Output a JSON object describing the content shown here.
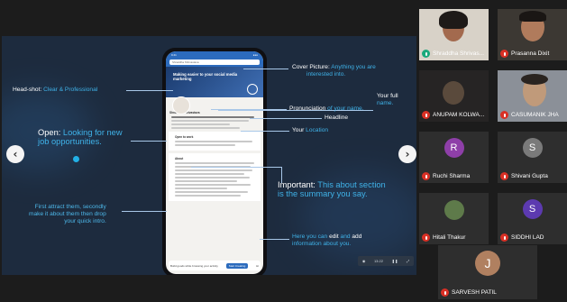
{
  "slide": {
    "annotations": {
      "headshot_label": "Head-shot:",
      "headshot_value": "Clear & Professional",
      "cover_label": "Cover Picture:",
      "cover_value_1": "Anything you are",
      "cover_value_2": "interested  into.",
      "fullname_1": "Your full",
      "fullname_2": "name.",
      "pronunciation_label": "Pronunciation",
      "pronunciation_rest": " of your name.",
      "headline": "Headline",
      "location_prefix": "Your ",
      "location_value": "Location",
      "open_label": "Open:",
      "open_value_1": "Looking for new",
      "open_value_2": "job opportunities.",
      "important_label": "Important:",
      "important_value_1": "This about section",
      "important_value_2": "is the summary you say.",
      "attract_1": "First attract them, secondly",
      "attract_2": "make it about them then drop",
      "attract_3": "your quick intro.",
      "edit_1_a": "Here you can ",
      "edit_1_b": "edit",
      "edit_1_c": " and ",
      "edit_1_d": "add",
      "edit_2": "information about you."
    },
    "phone": {
      "search_text": "Shraddha Shrivastava",
      "cover_line_1": "Making easier to your social media",
      "cover_line_2": "marketing",
      "name": "Shraddha Shrivastava",
      "section_about": "About",
      "open_to_work": "Open to work",
      "bottom_prompt": "Build goods while browsing your activity",
      "bottom_button": "Start Creating",
      "closing": "Hi"
    },
    "control_bar": {
      "time": "13:22"
    },
    "nav": {
      "prev": "‹",
      "next": "›"
    }
  },
  "participants": [
    {
      "name": "Shraddha Shrivas...",
      "muted": false,
      "avatar": "video"
    },
    {
      "name": "Prasanna Dixit",
      "muted": true,
      "avatar": "video"
    },
    {
      "name": "ANUPAM KOLWA...",
      "muted": true,
      "avatar": "video"
    },
    {
      "name": "CASUMANIK JHA",
      "muted": true,
      "avatar": "video"
    },
    {
      "name": "Ruchi Sharma",
      "muted": true,
      "avatar": "initial",
      "initial": "R",
      "color": "#8e3fa8"
    },
    {
      "name": "Shivani Gupta",
      "muted": true,
      "avatar": "initial",
      "initial": "S",
      "color": "#7a7a7a"
    },
    {
      "name": "Hitali Thakur",
      "muted": true,
      "avatar": "video"
    },
    {
      "name": "SIDDHI LAD",
      "muted": true,
      "avatar": "initial",
      "initial": "S",
      "color": "#5c3ab0"
    },
    {
      "name": "SARVESH PATIL",
      "muted": true,
      "avatar": "initial",
      "initial": "J",
      "color": "#b08060"
    }
  ],
  "colors": {
    "accent": "#3fb2e8",
    "slide_bg": "#1d2b3e",
    "muted_icon": "#d93025",
    "unmuted_icon": "#19a97b"
  }
}
